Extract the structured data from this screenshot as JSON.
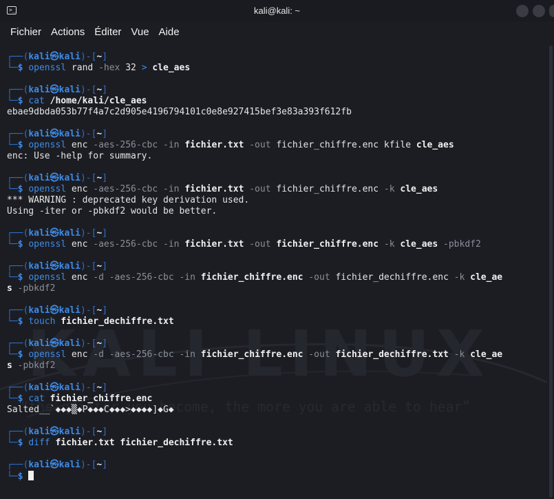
{
  "window": {
    "title": "kali@kali: ~"
  },
  "menu": [
    "Fichier",
    "Actions",
    "Éditer",
    "Vue",
    "Aide"
  ],
  "prompt": {
    "user": "kali",
    "host": "kali",
    "dir": "~",
    "symbol": "$"
  },
  "terminal_icon": "terminal-icon",
  "watermark": {
    "text": "KALI LINUX",
    "tagline": "“the quieter you become, the more you are able to hear”"
  },
  "lines": [
    {
      "kind": "prompt"
    },
    {
      "kind": "cmd",
      "parts": [
        {
          "t": "openssl",
          "c": "cmd"
        },
        {
          "t": " rand ",
          "c": "plain"
        },
        {
          "t": "-hex",
          "c": "opt"
        },
        {
          "t": " 32 ",
          "c": "plain"
        },
        {
          "t": ">",
          "c": "cmd"
        },
        {
          "t": " ",
          "c": "plain"
        },
        {
          "t": "cle_aes",
          "c": "bold"
        }
      ]
    },
    {
      "kind": "gap"
    },
    {
      "kind": "prompt"
    },
    {
      "kind": "cmd",
      "parts": [
        {
          "t": "cat",
          "c": "cmd"
        },
        {
          "t": " ",
          "c": "plain"
        },
        {
          "t": "/home/kali/cle_aes",
          "c": "bold"
        }
      ]
    },
    {
      "kind": "out",
      "text": "ebae9dbda053b77f4a7c2d905e4196794101c0e8e927415bef3e83a393f612fb"
    },
    {
      "kind": "gap"
    },
    {
      "kind": "prompt"
    },
    {
      "kind": "cmd",
      "parts": [
        {
          "t": "openssl",
          "c": "cmd"
        },
        {
          "t": " enc ",
          "c": "plain"
        },
        {
          "t": "-aes-256-cbc",
          "c": "opt"
        },
        {
          "t": " ",
          "c": "plain"
        },
        {
          "t": "-in",
          "c": "opt"
        },
        {
          "t": " ",
          "c": "plain"
        },
        {
          "t": "fichier.txt",
          "c": "bold"
        },
        {
          "t": " ",
          "c": "plain"
        },
        {
          "t": "-out",
          "c": "opt"
        },
        {
          "t": " fichier_chiffre.enc kfile ",
          "c": "plain"
        },
        {
          "t": "cle_aes",
          "c": "bold"
        }
      ]
    },
    {
      "kind": "out",
      "text": "enc: Use -help for summary."
    },
    {
      "kind": "gap"
    },
    {
      "kind": "prompt"
    },
    {
      "kind": "cmd",
      "parts": [
        {
          "t": "openssl",
          "c": "cmd"
        },
        {
          "t": " enc ",
          "c": "plain"
        },
        {
          "t": "-aes-256-cbc",
          "c": "opt"
        },
        {
          "t": " ",
          "c": "plain"
        },
        {
          "t": "-in",
          "c": "opt"
        },
        {
          "t": " ",
          "c": "plain"
        },
        {
          "t": "fichier.txt",
          "c": "bold"
        },
        {
          "t": " ",
          "c": "plain"
        },
        {
          "t": "-out",
          "c": "opt"
        },
        {
          "t": " fichier_chiffre.enc ",
          "c": "plain"
        },
        {
          "t": "-k",
          "c": "opt"
        },
        {
          "t": " ",
          "c": "plain"
        },
        {
          "t": "cle_aes",
          "c": "bold"
        }
      ]
    },
    {
      "kind": "out",
      "text": "*** WARNING : deprecated key derivation used."
    },
    {
      "kind": "out",
      "text": "Using -iter or -pbkdf2 would be better."
    },
    {
      "kind": "gap"
    },
    {
      "kind": "prompt"
    },
    {
      "kind": "cmd",
      "parts": [
        {
          "t": "openssl",
          "c": "cmd"
        },
        {
          "t": " enc ",
          "c": "plain"
        },
        {
          "t": "-aes-256-cbc",
          "c": "opt"
        },
        {
          "t": " ",
          "c": "plain"
        },
        {
          "t": "-in",
          "c": "opt"
        },
        {
          "t": " ",
          "c": "plain"
        },
        {
          "t": "fichier.txt",
          "c": "bold"
        },
        {
          "t": " ",
          "c": "plain"
        },
        {
          "t": "-out",
          "c": "opt"
        },
        {
          "t": " ",
          "c": "plain"
        },
        {
          "t": "fichier_chiffre.enc",
          "c": "bold"
        },
        {
          "t": " ",
          "c": "plain"
        },
        {
          "t": "-k",
          "c": "opt"
        },
        {
          "t": " ",
          "c": "plain"
        },
        {
          "t": "cle_aes",
          "c": "bold"
        },
        {
          "t": " ",
          "c": "plain"
        },
        {
          "t": "-pbkdf2",
          "c": "opt"
        }
      ]
    },
    {
      "kind": "gap"
    },
    {
      "kind": "prompt"
    },
    {
      "kind": "cmd",
      "parts": [
        {
          "t": "openssl",
          "c": "cmd"
        },
        {
          "t": " enc ",
          "c": "plain"
        },
        {
          "t": "-d",
          "c": "opt"
        },
        {
          "t": " ",
          "c": "plain"
        },
        {
          "t": "-aes-256-cbc",
          "c": "opt"
        },
        {
          "t": " ",
          "c": "plain"
        },
        {
          "t": "-in",
          "c": "opt"
        },
        {
          "t": " ",
          "c": "plain"
        },
        {
          "t": "fichier_chiffre.enc",
          "c": "bold"
        },
        {
          "t": " ",
          "c": "plain"
        },
        {
          "t": "-out",
          "c": "opt"
        },
        {
          "t": " fichier_dechiffre.enc ",
          "c": "plain"
        },
        {
          "t": "-k",
          "c": "opt"
        },
        {
          "t": " ",
          "c": "plain"
        },
        {
          "t": "cle_ae",
          "c": "bold"
        }
      ]
    },
    {
      "kind": "wrap",
      "parts": [
        {
          "t": "s",
          "c": "bold"
        },
        {
          "t": " ",
          "c": "plain"
        },
        {
          "t": "-pbkdf2",
          "c": "opt"
        }
      ]
    },
    {
      "kind": "gap"
    },
    {
      "kind": "prompt"
    },
    {
      "kind": "cmd",
      "parts": [
        {
          "t": "touch",
          "c": "cmd"
        },
        {
          "t": " ",
          "c": "plain"
        },
        {
          "t": "fichier_dechiffre.txt",
          "c": "bold"
        }
      ]
    },
    {
      "kind": "gap"
    },
    {
      "kind": "prompt"
    },
    {
      "kind": "cmd",
      "parts": [
        {
          "t": "openssl",
          "c": "cmd"
        },
        {
          "t": " enc ",
          "c": "plain"
        },
        {
          "t": "-d",
          "c": "opt"
        },
        {
          "t": " ",
          "c": "plain"
        },
        {
          "t": "-aes-256-cbc",
          "c": "opt"
        },
        {
          "t": " ",
          "c": "plain"
        },
        {
          "t": "-in",
          "c": "opt"
        },
        {
          "t": " ",
          "c": "plain"
        },
        {
          "t": "fichier_chiffre.enc",
          "c": "bold"
        },
        {
          "t": " ",
          "c": "plain"
        },
        {
          "t": "-out",
          "c": "opt"
        },
        {
          "t": " ",
          "c": "plain"
        },
        {
          "t": "fichier_dechiffre.txt",
          "c": "bold"
        },
        {
          "t": " ",
          "c": "plain"
        },
        {
          "t": "-k",
          "c": "opt"
        },
        {
          "t": " ",
          "c": "plain"
        },
        {
          "t": "cle_ae",
          "c": "bold"
        }
      ]
    },
    {
      "kind": "wrap",
      "parts": [
        {
          "t": "s",
          "c": "bold"
        },
        {
          "t": " ",
          "c": "plain"
        },
        {
          "t": "-pbkdf2",
          "c": "opt"
        }
      ]
    },
    {
      "kind": "gap"
    },
    {
      "kind": "prompt"
    },
    {
      "kind": "cmd",
      "parts": [
        {
          "t": "cat",
          "c": "cmd"
        },
        {
          "t": " ",
          "c": "plain"
        },
        {
          "t": "fichier_chiffre.enc",
          "c": "bold"
        }
      ]
    },
    {
      "kind": "out",
      "text": "Salted__`◆◆◆▒◆P◆◆◆C◆◆◆>◆◆◆◆]◆G◆"
    },
    {
      "kind": "gap"
    },
    {
      "kind": "prompt"
    },
    {
      "kind": "cmd",
      "parts": [
        {
          "t": "diff",
          "c": "cmd"
        },
        {
          "t": " ",
          "c": "plain"
        },
        {
          "t": "fichier.txt",
          "c": "bold"
        },
        {
          "t": " ",
          "c": "plain"
        },
        {
          "t": "fichier_dechiffre.txt",
          "c": "bold"
        }
      ]
    },
    {
      "kind": "gap"
    },
    {
      "kind": "prompt"
    },
    {
      "kind": "cursor"
    }
  ]
}
